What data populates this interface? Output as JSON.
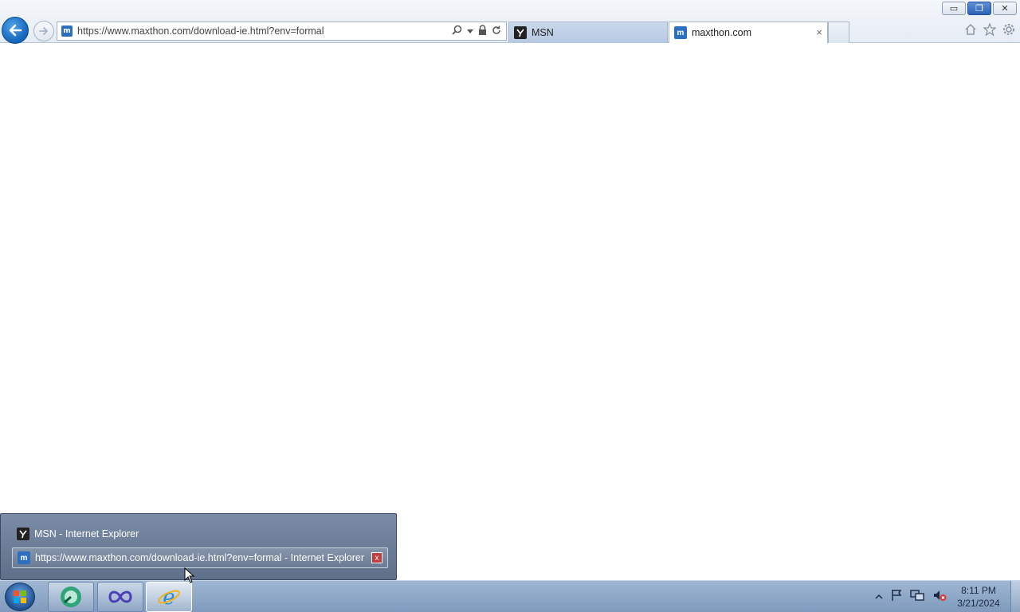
{
  "browser": {
    "address_url": "https://www.maxthon.com/download-ie.html?env=formal",
    "tabs": [
      {
        "title": "MSN",
        "favicon": "msn-favicon",
        "active": false
      },
      {
        "title": "maxthon.com",
        "favicon": "maxthon-favicon",
        "active": true,
        "close_glyph": "×"
      }
    ],
    "caption": {
      "minimize": "▭",
      "restore": "❐",
      "close": "✕"
    }
  },
  "jump_popup": {
    "items": [
      {
        "label": "MSN - Internet Explorer",
        "icon": "msn-favicon"
      },
      {
        "label": "https://www.maxthon.com/download-ie.html?env=formal - Internet Explorer",
        "icon": "maxthon-favicon",
        "close_glyph": "x"
      }
    ]
  },
  "taskbar": {
    "clock_time": "8:11 PM",
    "clock_date": "3/21/2024"
  },
  "colors": {
    "ie_blue": "#1463b8",
    "taskbar": "#8fa8c8",
    "popup": "#6b7c96"
  }
}
